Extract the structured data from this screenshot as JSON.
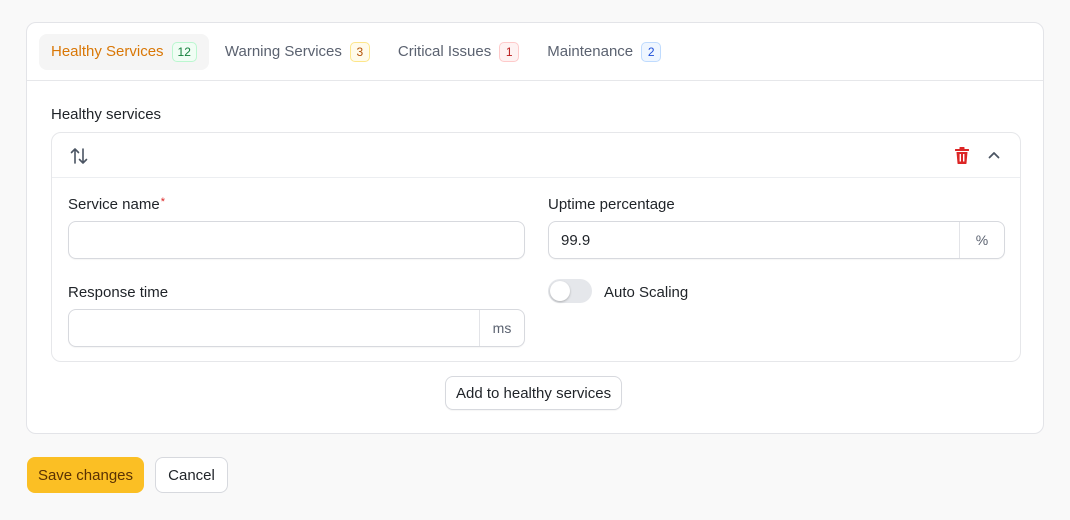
{
  "tabs": [
    {
      "label": "Healthy Services",
      "count": "12",
      "badge_color": "#15803d",
      "active": true
    },
    {
      "label": "Warning Services",
      "count": "3",
      "badge_color": "#b45309",
      "active": false
    },
    {
      "label": "Critical Issues",
      "count": "1",
      "badge_color": "#b91c1c",
      "active": false
    },
    {
      "label": "Maintenance",
      "count": "2",
      "badge_color": "#1d4ed8",
      "active": false
    }
  ],
  "section": {
    "label": "Healthy services"
  },
  "item": {
    "icons": {
      "reorder": "reorder-icon",
      "delete": "trash-icon",
      "collapse": "chevron-up-icon"
    },
    "service_name": {
      "label": "Service name",
      "required_mark": "*",
      "value": ""
    },
    "uptime": {
      "label": "Uptime percentage",
      "value": "99.9",
      "suffix": "%"
    },
    "response_time": {
      "label": "Response time",
      "value": "",
      "suffix": "ms"
    },
    "auto_scaling": {
      "label": "Auto Scaling",
      "enabled": false
    }
  },
  "actions": {
    "add_label": "Add to healthy services",
    "save_label": "Save changes",
    "cancel_label": "Cancel"
  },
  "colors": {
    "accent": "#fbbf24",
    "active_tab_text": "#d97706",
    "danger": "#dc2626"
  }
}
